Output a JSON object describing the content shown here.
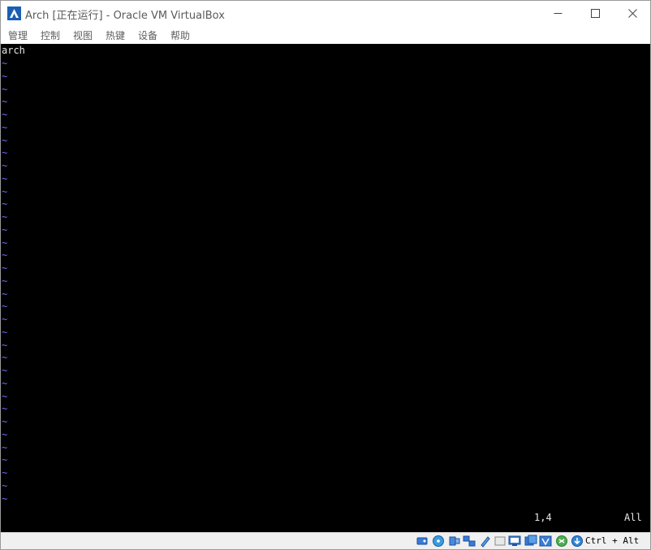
{
  "window": {
    "title": "Arch [正在运行] - Oracle VM VirtualBox",
    "app_icon": "virtualbox-icon"
  },
  "menu": {
    "items": [
      "管理",
      "控制",
      "视图",
      "热键",
      "设备",
      "帮助"
    ]
  },
  "terminal": {
    "first_line": "arch",
    "tilde": "~",
    "cursor_position": "1,4",
    "scroll_position": "All"
  },
  "statusbar": {
    "icons": [
      "hard-disk-icon",
      "optical-drive-icon",
      "audio-icon",
      "network-icon",
      "usb-icon",
      "shared-folders-icon",
      "display-icon",
      "recording-icon",
      "virtualization-icon",
      "mouse-integration-icon",
      "keyboard-capture-icon"
    ],
    "host_key": "Ctrl + Alt"
  },
  "colors": {
    "terminal_bg": "#000000",
    "tilde": "#6e6eff",
    "text": "#e8e8e8"
  }
}
